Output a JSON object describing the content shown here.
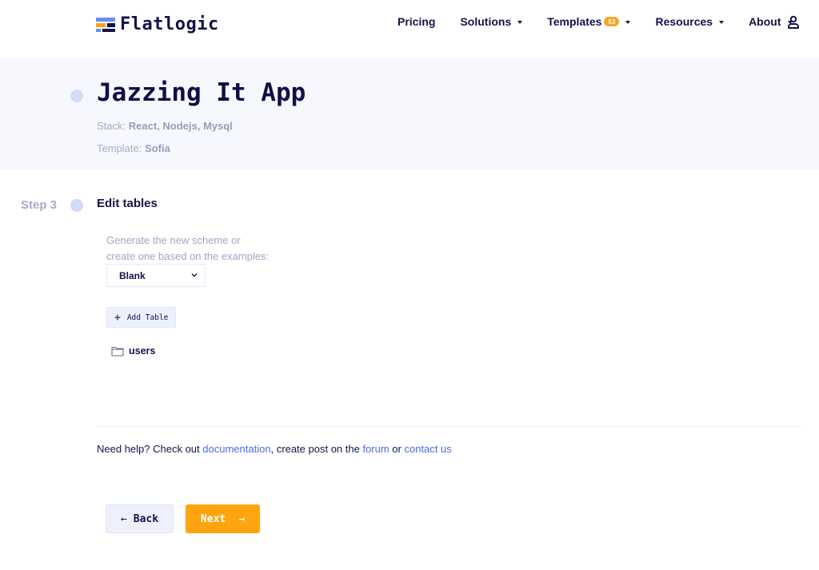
{
  "header": {
    "logo_text": "Flatlogic",
    "nav": [
      {
        "label": "Pricing",
        "has_dropdown": false
      },
      {
        "label": "Solutions",
        "has_dropdown": true
      },
      {
        "label": "Templates",
        "has_dropdown": true,
        "badge": "53"
      },
      {
        "label": "Resources",
        "has_dropdown": true
      },
      {
        "label": "About",
        "has_dropdown": true
      }
    ],
    "user_icon": "user-icon"
  },
  "hero": {
    "title": "Jazzing It App",
    "stack_label": "Stack:",
    "stack_value": "React, Nodejs, Mysql",
    "template_label": "Template:",
    "template_value": "Sofia"
  },
  "step": {
    "label": "Step 3",
    "title": "Edit tables",
    "scheme_description_line1": "Generate the new scheme or",
    "scheme_description_line2": "create one based on the examples:",
    "scheme_select_value": "Blank",
    "add_table_label": "Add Table",
    "tables": [
      {
        "name": "users",
        "icon": "folder-icon"
      }
    ]
  },
  "help": {
    "prefix": "Need help? Check out ",
    "documentation_link": "documentation",
    "middle": ", create post on the ",
    "forum_link": "forum",
    "or": " or ",
    "contact_link": "contact us"
  },
  "actions": {
    "back_label": "Back",
    "next_label": "Next"
  },
  "colors": {
    "brand_dark": "#14134a",
    "accent_orange": "#ffa50f",
    "link_blue": "#4a6de5",
    "hero_bg": "#f7f8fd",
    "dot": "#d2dcf8"
  }
}
